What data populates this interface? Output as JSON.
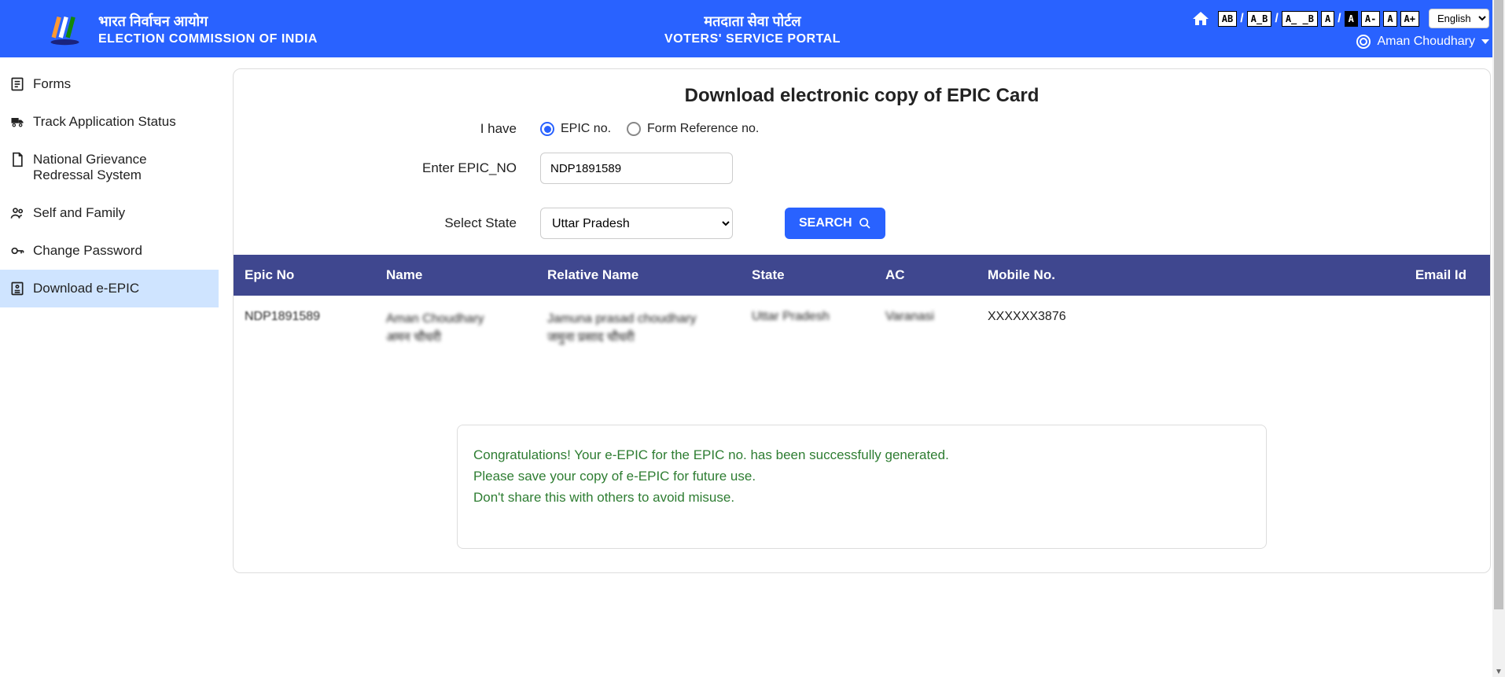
{
  "header": {
    "org_hi": "भारत निर्वाचन आयोग",
    "org_en": "ELECTION COMMISSION OF INDIA",
    "portal_hi": "मतदाता सेवा पोर्टल",
    "portal_en": "VOTERS' SERVICE PORTAL",
    "user_name": "Aman Choudhary",
    "language": "English",
    "acc": {
      "ab": "AB",
      "a_b": "A_B",
      "a__b": "A_ _B",
      "a1": "A",
      "a2": "A",
      "aminus": "A-",
      "anorm": "A",
      "aplus": "A+"
    }
  },
  "sidebar": {
    "forms": "Forms",
    "track": "Track Application Status",
    "grievance": "National Grievance Redressal System",
    "self_family": "Self and Family",
    "change_password": "Change Password",
    "download_epic": "Download e-EPIC"
  },
  "main": {
    "title": "Download electronic copy of EPIC Card",
    "i_have_label": "I have",
    "radio_epic": "EPIC no.",
    "radio_form": "Form Reference no.",
    "enter_epic_label": "Enter EPIC_NO",
    "epic_value": "NDP1891589",
    "select_state_label": "Select State",
    "state_value": "Uttar Pradesh",
    "search_btn": "SEARCH"
  },
  "table": {
    "headers": {
      "epic": "Epic No",
      "name": "Name",
      "relative": "Relative Name",
      "state": "State",
      "ac": "AC",
      "mobile": "Mobile No.",
      "email": "Email Id"
    },
    "row": {
      "epic": "NDP1891589",
      "name_en": "Aman Choudhary",
      "name_hi": "अमन चौधरी",
      "rel_en": "Jamuna prasad choudhary",
      "rel_hi": "जमुना प्रसाद चौधरी",
      "state": "Uttar Pradesh",
      "ac": "Varanasi",
      "mobile": "XXXXXX3876",
      "email": ""
    }
  },
  "success": {
    "line1": "Congratulations! Your e-EPIC for the EPIC no. has been successfully generated.",
    "line2": "Please save your copy of e-EPIC for future use.",
    "line3": "Don't share this with others to avoid misuse."
  }
}
